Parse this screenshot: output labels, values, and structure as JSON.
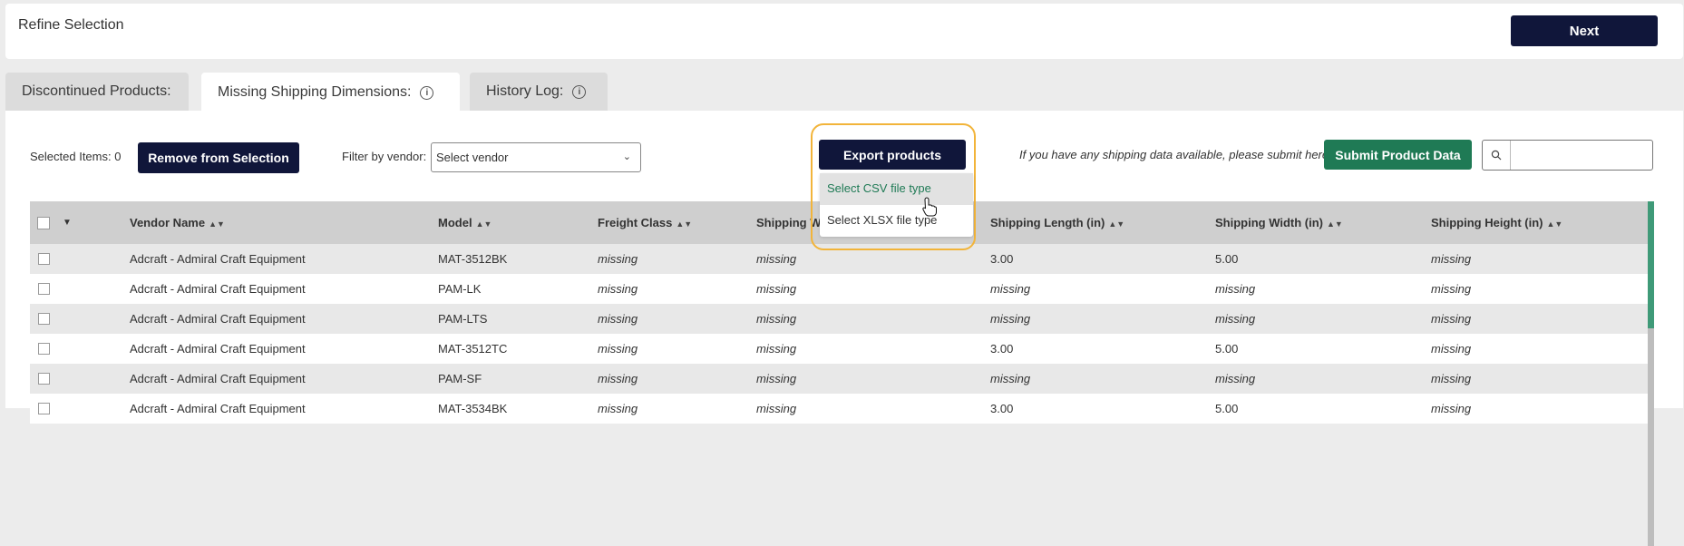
{
  "header": {
    "title": "Refine Selection",
    "next_label": "Next"
  },
  "tabs": [
    {
      "label": "Discontinued Products:"
    },
    {
      "label": "Missing Shipping Dimensions:",
      "active": true
    },
    {
      "label": "History Log:"
    }
  ],
  "toolbar": {
    "selected_items": "Selected Items: 0",
    "remove_label": "Remove from Selection",
    "filter_label": "Filter by vendor:",
    "vendor_placeholder": "Select vendor",
    "export_label": "Export products",
    "export_options": [
      "Select CSV file type",
      "Select XLSX file type"
    ],
    "help_text": "If you have any shipping data available, please submit here:",
    "submit_label": "Submit Product Data",
    "search_value": ""
  },
  "table": {
    "columns": [
      "Vendor Name",
      "Model",
      "Freight Class",
      "Shipping W",
      "Shipping Length (in)",
      "Shipping Width (in)",
      "Shipping Height (in)"
    ],
    "rows": [
      [
        "Adcraft - Admiral Craft Equipment",
        "MAT-3512BK",
        "missing",
        "missing",
        "3.00",
        "5.00",
        "missing"
      ],
      [
        "Adcraft - Admiral Craft Equipment",
        "PAM-LK",
        "missing",
        "missing",
        "missing",
        "missing",
        "missing"
      ],
      [
        "Adcraft - Admiral Craft Equipment",
        "PAM-LTS",
        "missing",
        "missing",
        "missing",
        "missing",
        "missing"
      ],
      [
        "Adcraft - Admiral Craft Equipment",
        "MAT-3512TC",
        "missing",
        "missing",
        "3.00",
        "5.00",
        "missing"
      ],
      [
        "Adcraft - Admiral Craft Equipment",
        "PAM-SF",
        "missing",
        "missing",
        "missing",
        "missing",
        "missing"
      ],
      [
        "Adcraft - Admiral Craft Equipment",
        "MAT-3534BK",
        "missing",
        "missing",
        "3.00",
        "5.00",
        "missing"
      ]
    ]
  },
  "colors": {
    "navy": "#10163a",
    "green": "#1f7a55",
    "highlight": "#f2b43a"
  }
}
